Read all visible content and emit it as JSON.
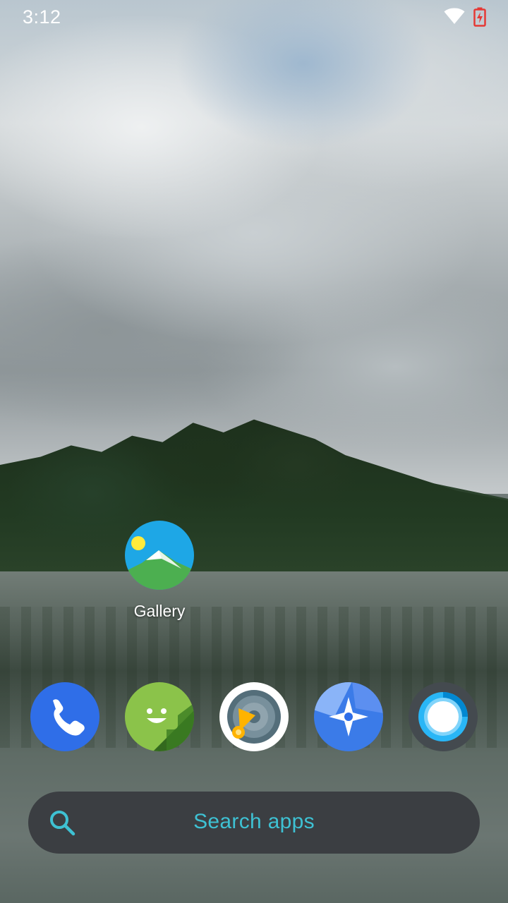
{
  "status_bar": {
    "time": "3:12",
    "icons": [
      "wifi-icon",
      "battery-charging-icon"
    ]
  },
  "desktop": {
    "shortcuts": [
      {
        "label": "Gallery",
        "icon": "gallery-icon"
      }
    ]
  },
  "dock": {
    "apps": [
      {
        "icon": "phone-icon",
        "color": "#2f6ee8"
      },
      {
        "icon": "messaging-icon",
        "color": "#8bc34a"
      },
      {
        "icon": "music-icon",
        "color": "#ffffff"
      },
      {
        "icon": "maps-icon",
        "color": "#3b7be8"
      },
      {
        "icon": "camera-icon",
        "color": "#444a4f"
      }
    ]
  },
  "search": {
    "label": "Search apps",
    "icon": "search-icon",
    "accent": "#3ec1d3"
  }
}
